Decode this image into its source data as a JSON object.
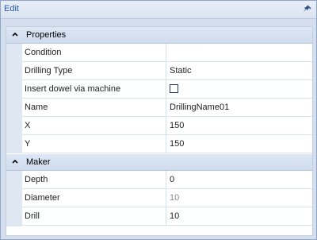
{
  "window": {
    "title": "Edit",
    "pin_icon": "pin-icon"
  },
  "categories": [
    {
      "label": "Properties",
      "rows": [
        {
          "name": "Condition",
          "value": ""
        },
        {
          "name": "Drilling Type",
          "value": "Static"
        },
        {
          "name": "Insert dowel via machine",
          "value": "",
          "checkbox": false
        },
        {
          "name": "Name",
          "value": "DrillingName01"
        },
        {
          "name": "X",
          "value": "150"
        },
        {
          "name": "Y",
          "value": "150"
        }
      ]
    },
    {
      "label": "Maker",
      "rows": [
        {
          "name": "Depth",
          "value": "0"
        },
        {
          "name": "Diameter",
          "value": "10"
        },
        {
          "name": "Drill",
          "value": "10"
        }
      ]
    }
  ],
  "colors": {
    "title_text": "#2a5ba8",
    "category_band": "#d4e0f0",
    "disabled_text": "#8a8a8a"
  }
}
